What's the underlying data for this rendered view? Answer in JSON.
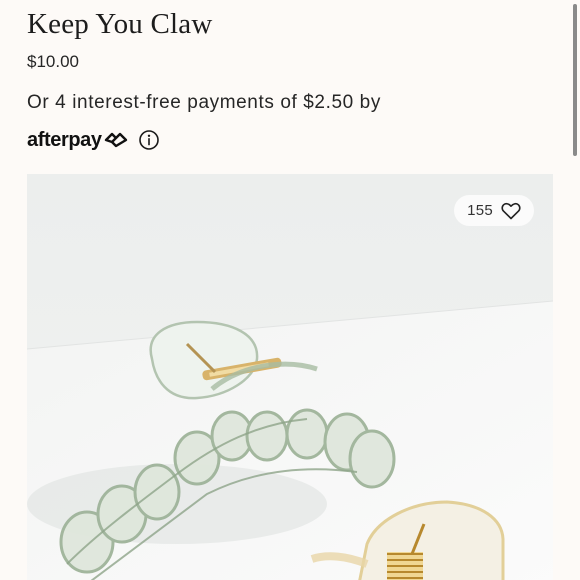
{
  "product": {
    "title": "Keep You Claw",
    "price": "$10.00"
  },
  "payment": {
    "installments_text": "Or 4 interest-free payments of $2.50 by",
    "provider_name": "afterpay",
    "provider_icon": "afterpay-loop-icon",
    "info_icon": "info-icon"
  },
  "gallery": {
    "like_count": "155",
    "like_icon": "heart-icon"
  },
  "colors": {
    "background": "#fdfaf7",
    "text": "#1f1f1f",
    "pill": "#fbfbfb"
  }
}
